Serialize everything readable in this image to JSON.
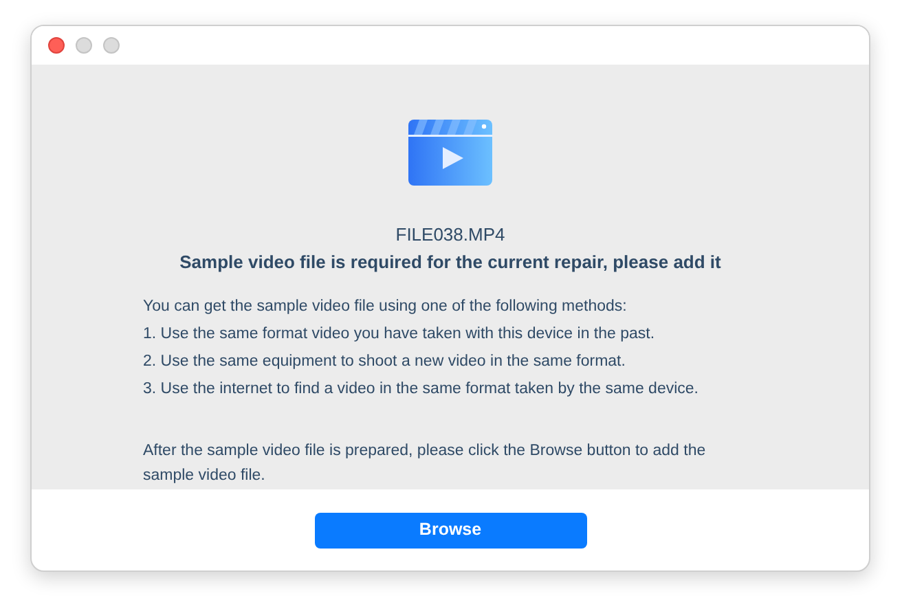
{
  "file_name": "FILE038.MP4",
  "heading": "Sample video file is required for the current repair, please add it",
  "methods_intro": "You can get the sample video file using one of the following methods:",
  "methods": [
    "1. Use the same format video you have taken with this device in the past.",
    "2. Use the same equipment to shoot a new video in the same format.",
    "3. Use the internet to find a video in the same format taken by the same device."
  ],
  "instruction": "After the sample video file is prepared,  please click the Browse button to add the sample video file.",
  "button": "Browse"
}
